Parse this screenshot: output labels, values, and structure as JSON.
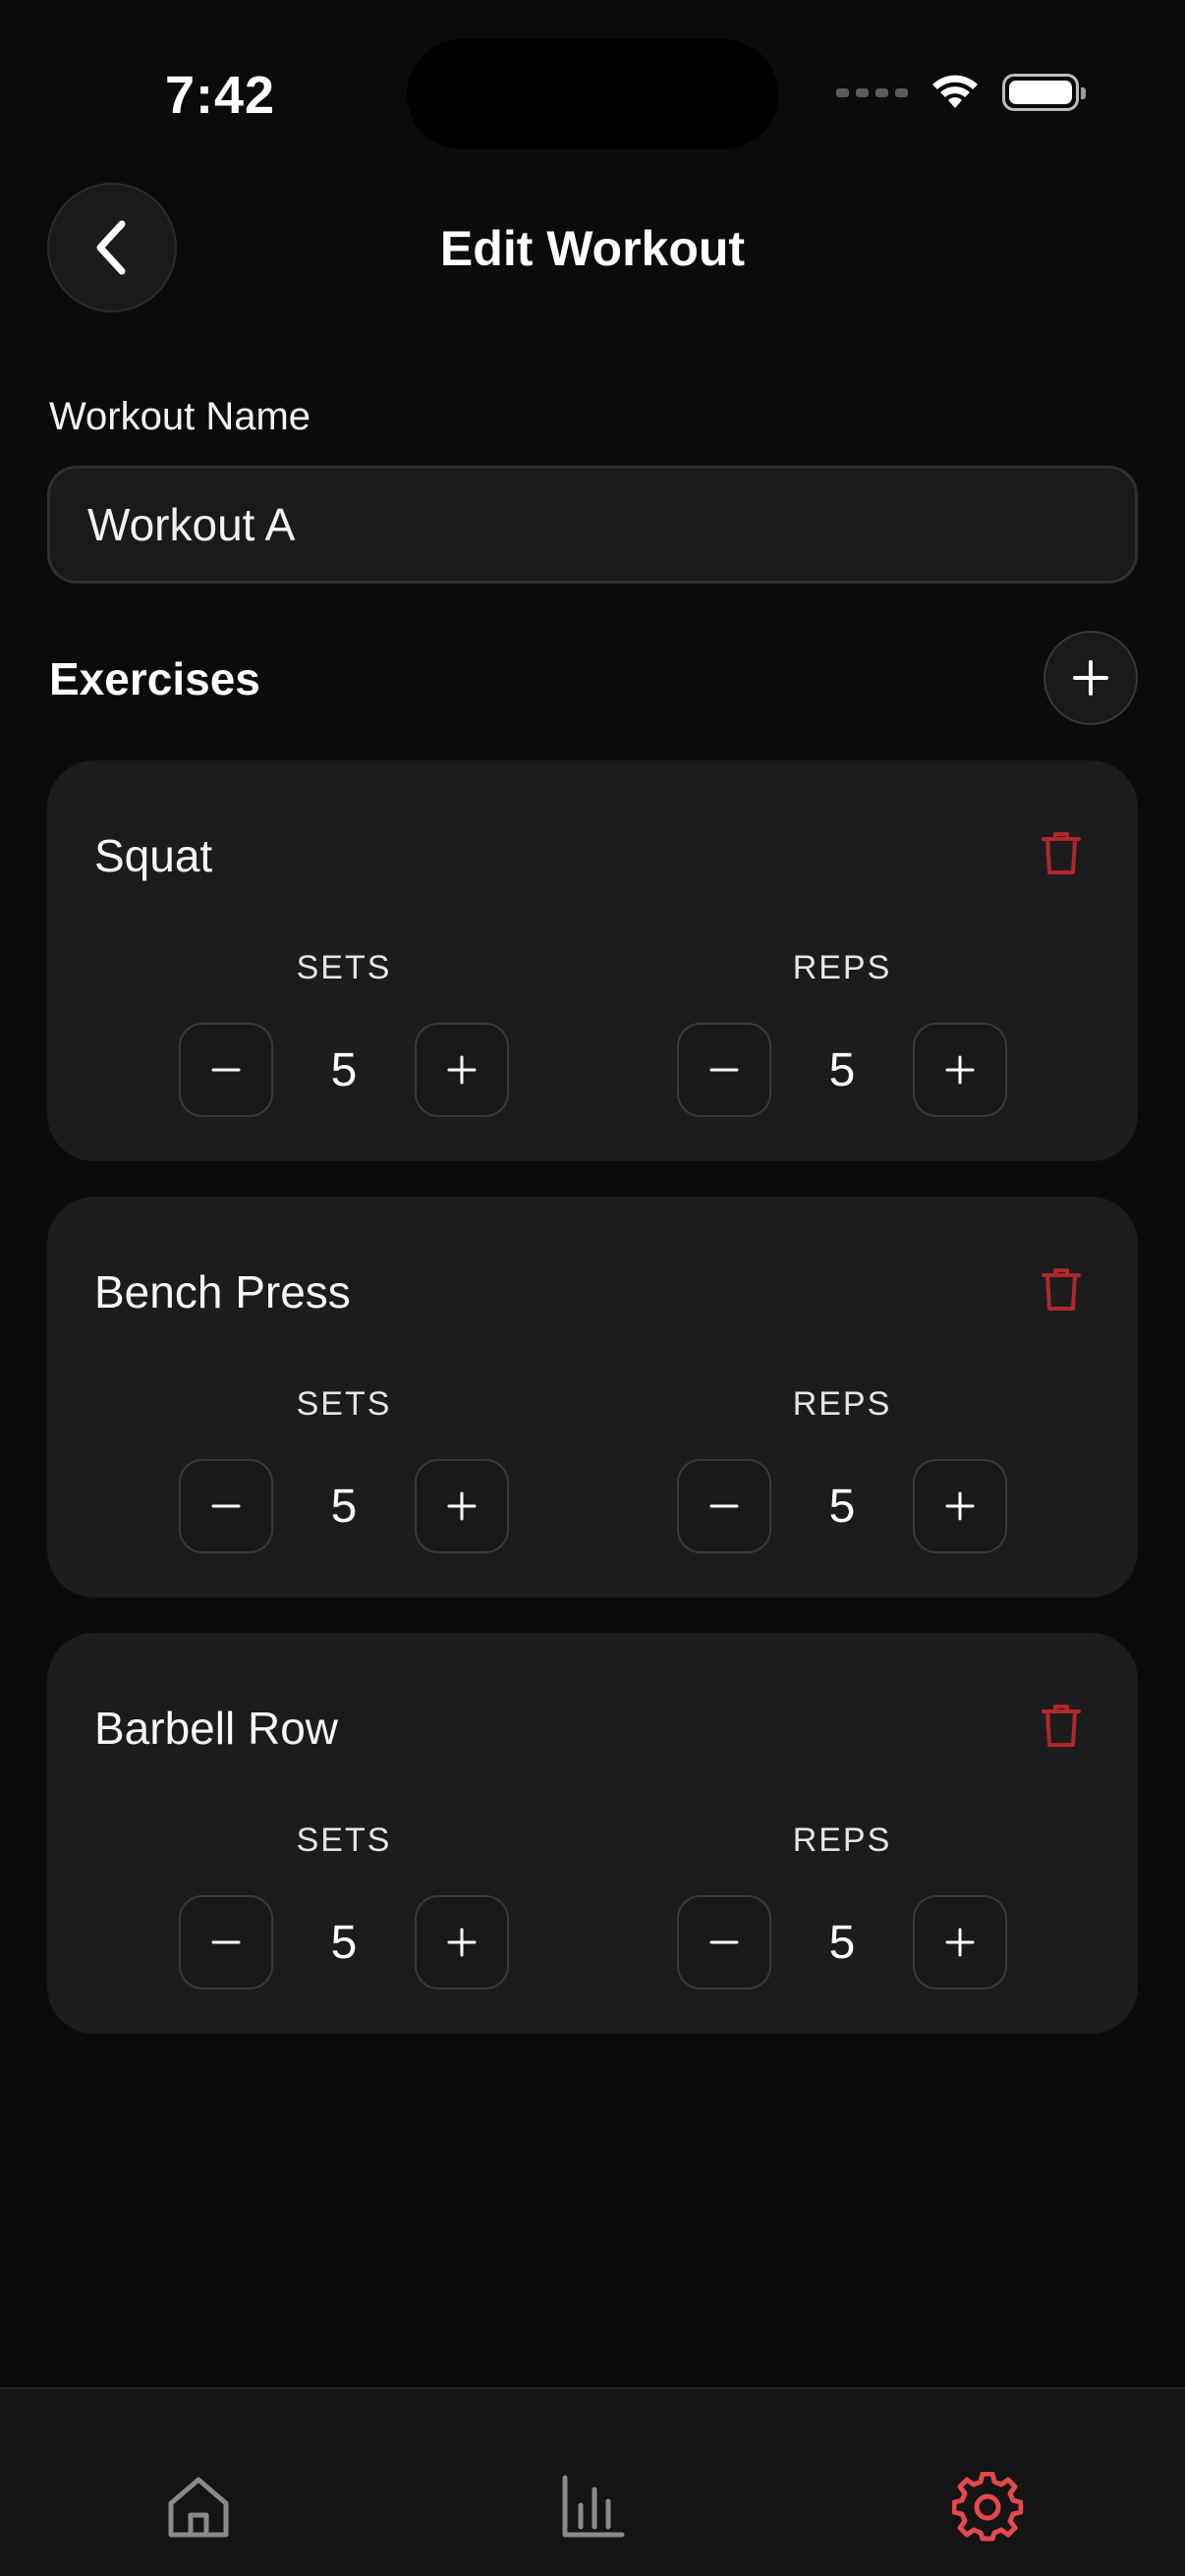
{
  "status_bar": {
    "time": "7:42"
  },
  "header": {
    "title": "Edit Workout",
    "back_icon": "chevron-left-icon"
  },
  "workout_name": {
    "label": "Workout Name",
    "value": "Workout A"
  },
  "exercises_section": {
    "title": "Exercises",
    "add_icon": "plus-icon"
  },
  "exercises": [
    {
      "name": "Squat",
      "sets_label": "SETS",
      "sets": "5",
      "reps_label": "REPS",
      "reps": "5"
    },
    {
      "name": "Bench Press",
      "sets_label": "SETS",
      "sets": "5",
      "reps_label": "REPS",
      "reps": "5"
    },
    {
      "name": "Barbell Row",
      "sets_label": "SETS",
      "sets": "5",
      "reps_label": "REPS",
      "reps": "5"
    }
  ],
  "tab_bar": {
    "items": [
      {
        "icon": "home-icon",
        "active": false
      },
      {
        "icon": "bar-chart-icon",
        "active": false
      },
      {
        "icon": "gear-icon",
        "active": true
      }
    ]
  },
  "colors": {
    "background": "#0b0b0b",
    "card": "#1c1c1e",
    "danger": "#b3262b",
    "accent_active": "#e5484d",
    "inactive_icon": "#8a8a8e"
  }
}
